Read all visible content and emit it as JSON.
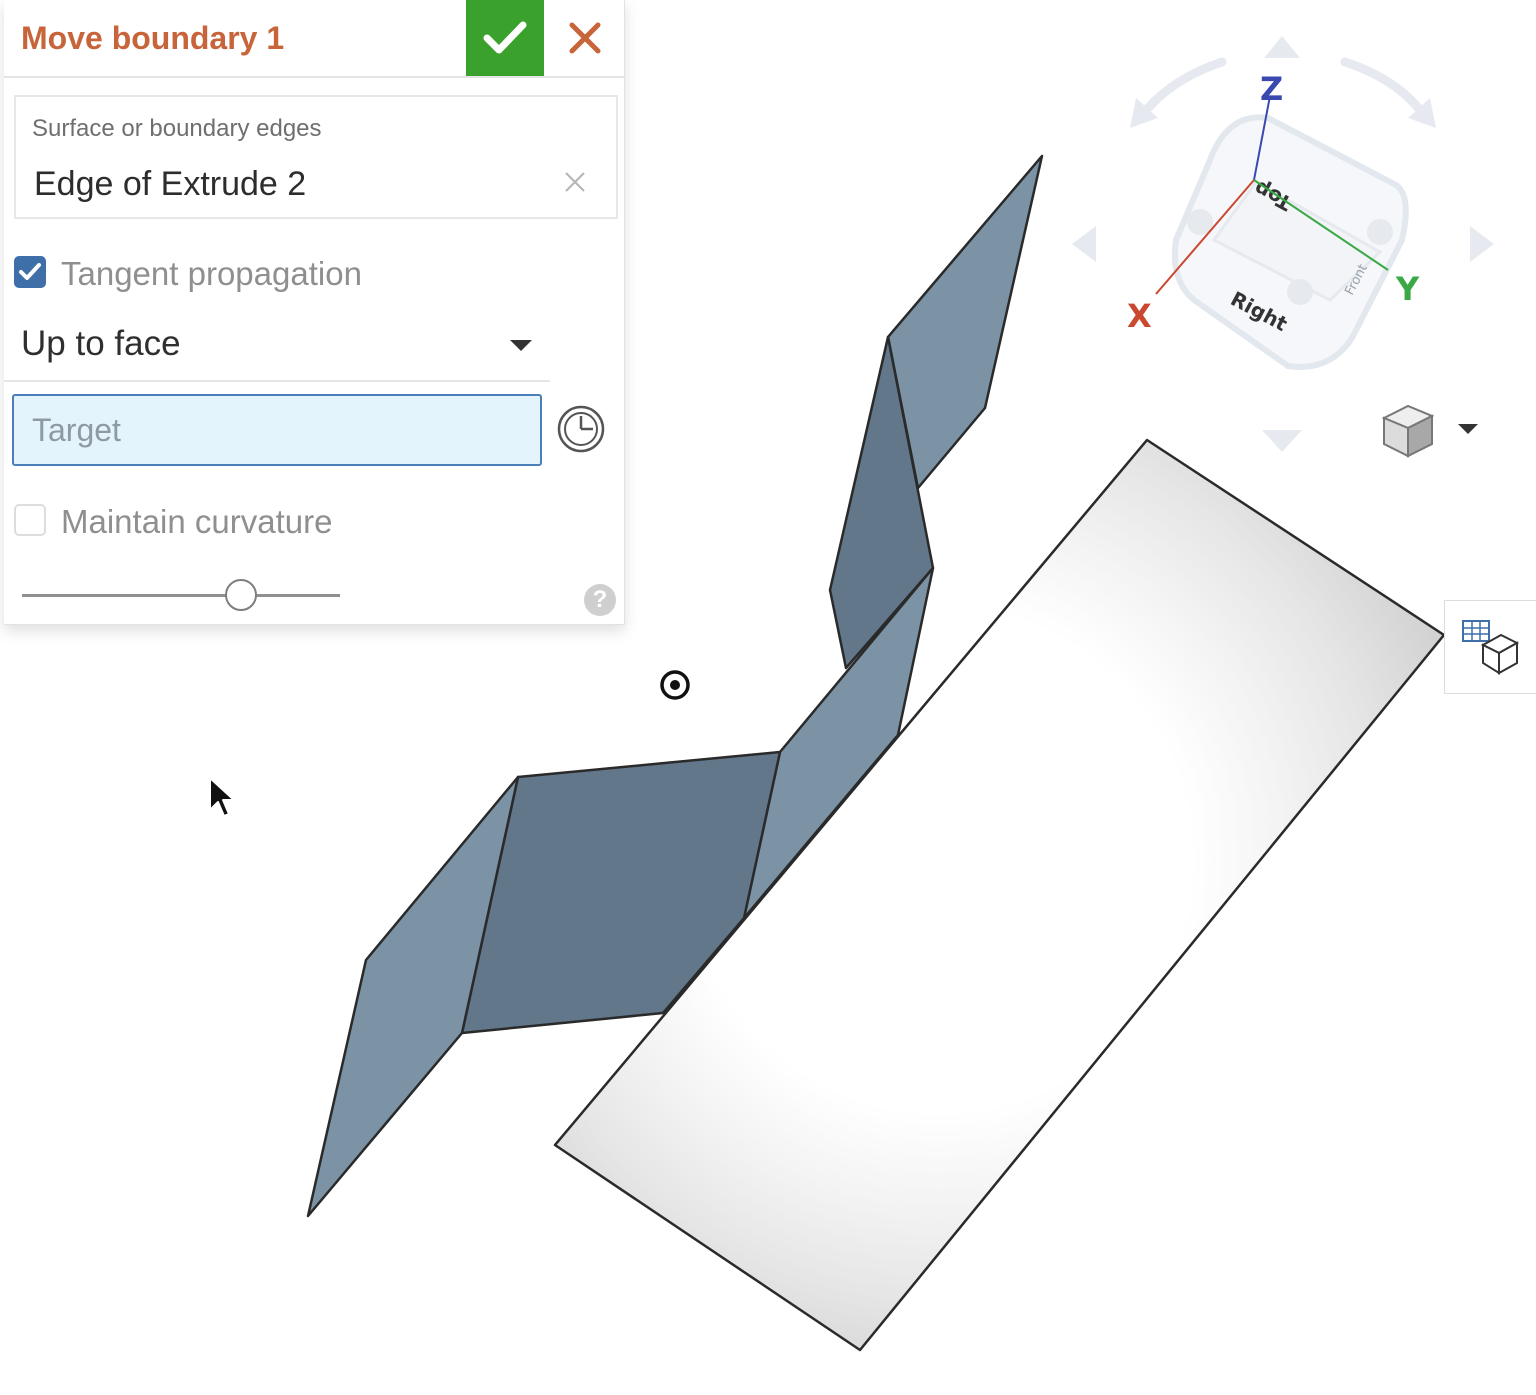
{
  "dialog": {
    "title": "Move boundary 1",
    "ok_icon": "check-icon",
    "cancel_icon": "close-icon",
    "accent_color": "#c8643a",
    "ok_color": "#3aa12c"
  },
  "selection": {
    "label": "Surface or boundary edges",
    "value": "Edge of Extrude 2"
  },
  "tangent_propagation": {
    "label": "Tangent propagation",
    "checked": true
  },
  "end_condition": {
    "value": "Up to face"
  },
  "target": {
    "placeholder": "Target"
  },
  "maintain_curvature": {
    "label": "Maintain curvature",
    "checked": false
  },
  "slider": {
    "value_fraction": 0.69
  },
  "help": {
    "label": "?"
  },
  "view_cube": {
    "faces": [
      "Top",
      "Right",
      "Front"
    ],
    "axes": {
      "x": {
        "label": "X",
        "color": "#c9482f"
      },
      "y": {
        "label": "Y",
        "color": "#39a845"
      },
      "z": {
        "label": "Z",
        "color": "#3a48b0"
      }
    }
  },
  "colors": {
    "surface_light": "#7b93a5",
    "surface_dark": "#63778a",
    "selection_blue": "#4a7fb9"
  }
}
